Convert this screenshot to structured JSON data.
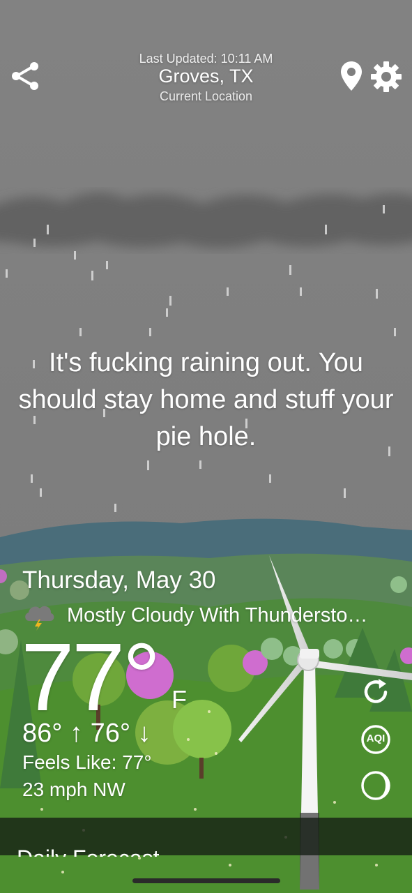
{
  "header": {
    "last_updated": "Last Updated: 10:11 AM",
    "city": "Groves, TX",
    "location_label": "Current Location"
  },
  "message": "It's fucking raining out. You should stay home and stuff your pie hole.",
  "forecast": {
    "date": "Thursday, May 30",
    "condition": "Mostly Cloudy With Thundersto…",
    "condition_icon": "thunderstorm-cloud-icon",
    "temperature": "77°",
    "unit": "F",
    "high_low": "86° ↑ 76° ↓",
    "feels_like": "Feels Like: 77°",
    "wind": "23 mph NW"
  },
  "side_actions": [
    {
      "icon": "refresh-icon"
    },
    {
      "icon": "aqi-icon",
      "label": "AQI"
    },
    {
      "icon": "moon-phase-icon"
    }
  ],
  "bottom": {
    "daily_label": "Daily Forecast"
  },
  "colors": {
    "sky": "#7f7f7f",
    "cloud": "#5f5f5f",
    "mountains": "#456a78",
    "grass": "#4f8f2e"
  }
}
